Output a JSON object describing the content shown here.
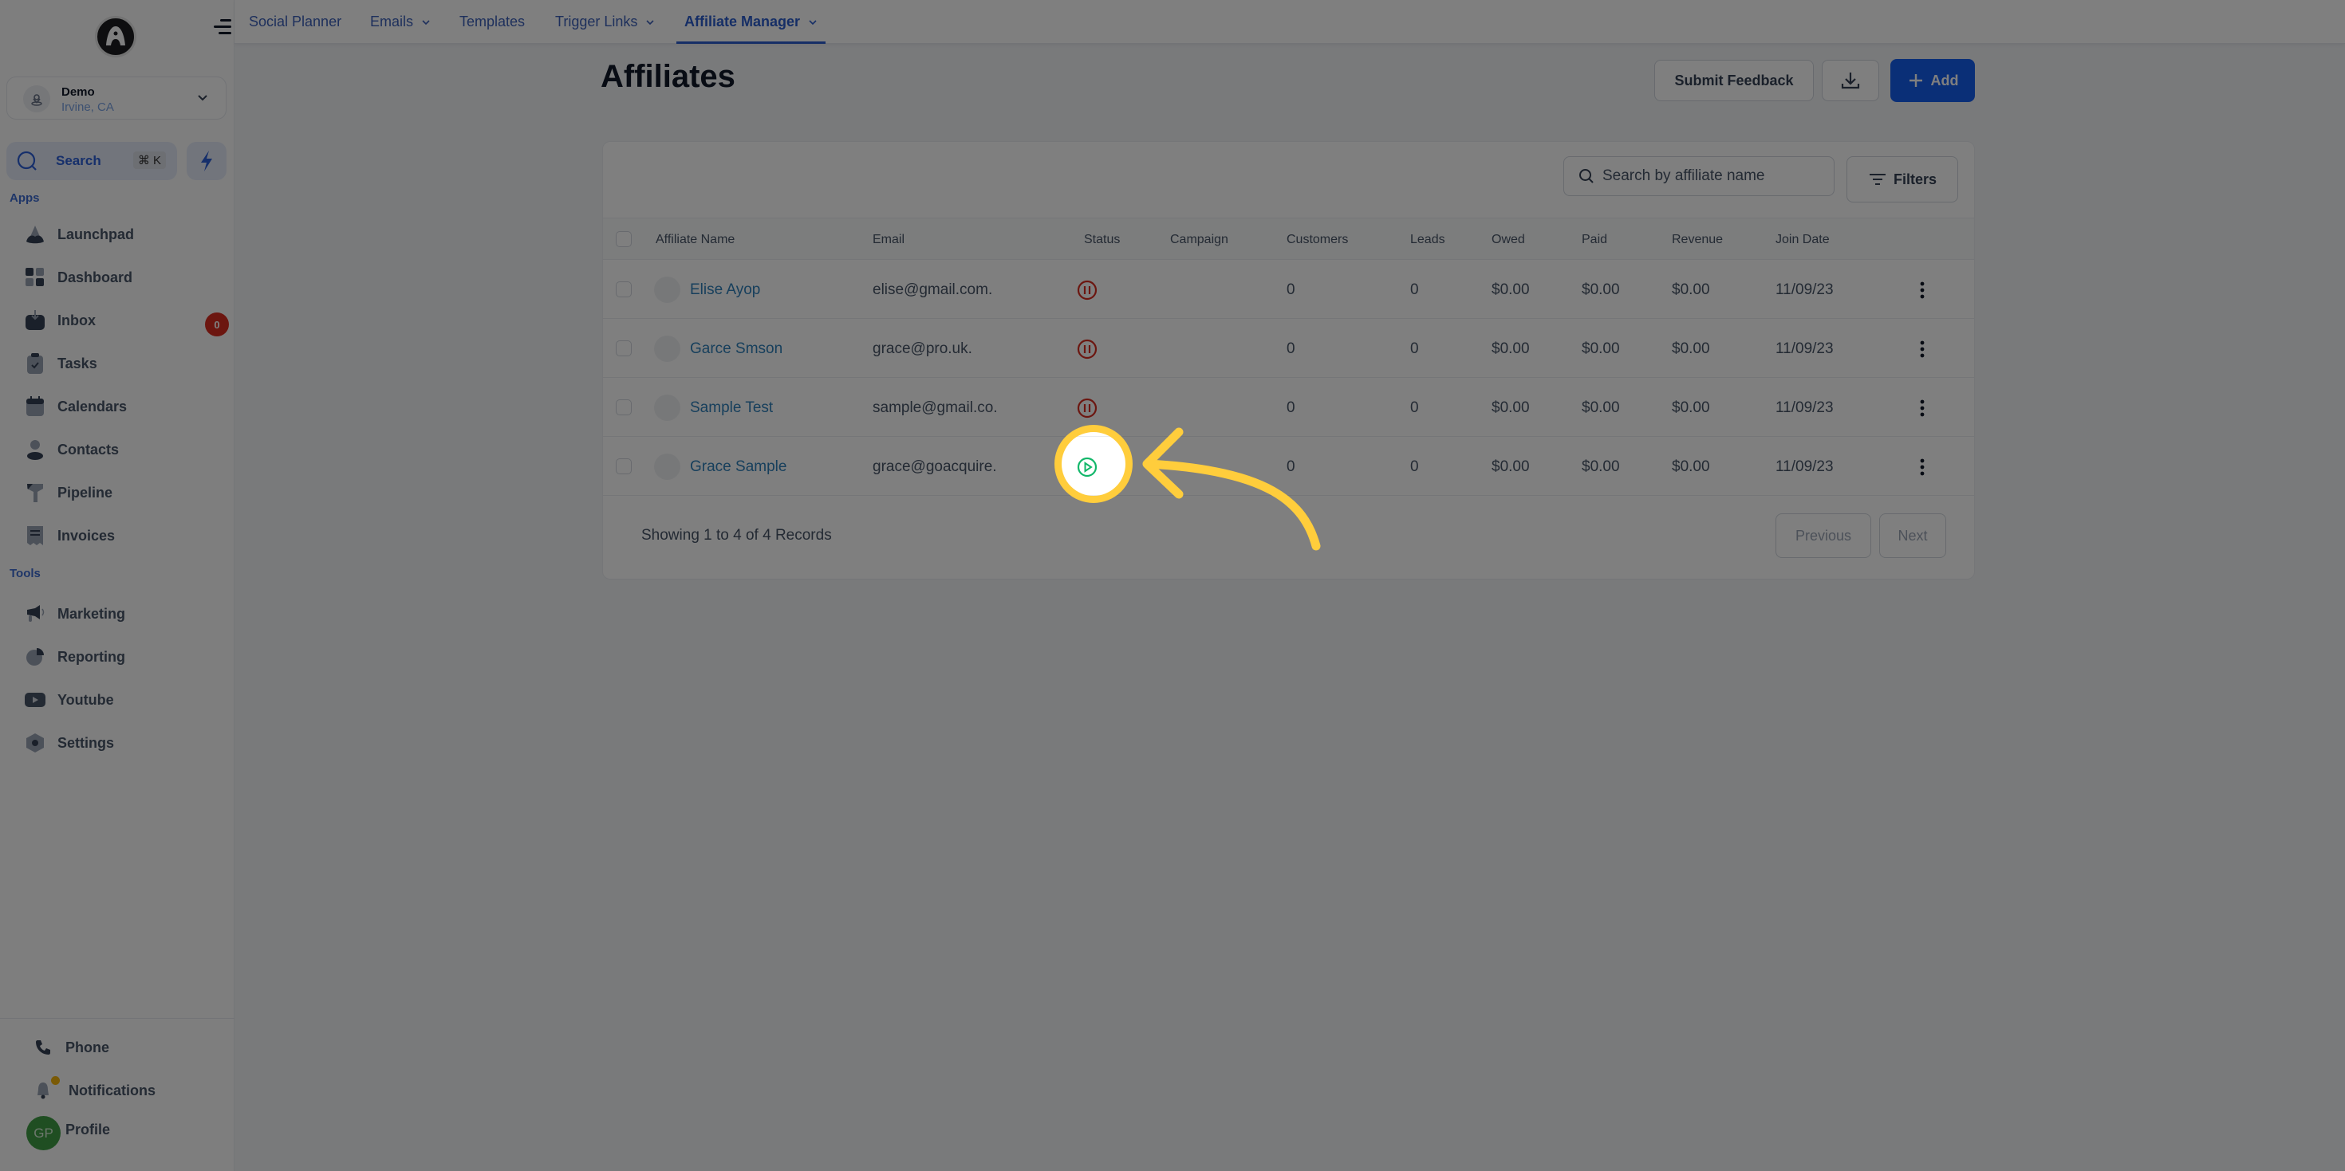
{
  "sidebar": {
    "location": {
      "name": "Demo",
      "city": "Irvine, CA"
    },
    "search": {
      "label": "Search",
      "shortcut": "⌘ K"
    },
    "sections": {
      "apps": "Apps",
      "tools": "Tools"
    },
    "apps": [
      {
        "label": "Launchpad",
        "icon": "rocket-icon"
      },
      {
        "label": "Dashboard",
        "icon": "dashboard-icon"
      },
      {
        "label": "Inbox",
        "icon": "inbox-icon",
        "badge": "0"
      },
      {
        "label": "Tasks",
        "icon": "clipboard-check-icon"
      },
      {
        "label": "Calendars",
        "icon": "calendar-icon"
      },
      {
        "label": "Contacts",
        "icon": "user-icon"
      },
      {
        "label": "Pipeline",
        "icon": "funnel-icon"
      },
      {
        "label": "Invoices",
        "icon": "receipt-icon"
      }
    ],
    "tools": [
      {
        "label": "Marketing",
        "icon": "megaphone-icon"
      },
      {
        "label": "Reporting",
        "icon": "pie-chart-icon"
      },
      {
        "label": "Youtube",
        "icon": "youtube-icon"
      },
      {
        "label": "Settings",
        "icon": "settings-hex-icon"
      }
    ],
    "bottom": {
      "phone": "Phone",
      "notifications": "Notifications",
      "profile": "Profile",
      "profile_initials": "GP"
    }
  },
  "topnav": {
    "tabs": [
      {
        "label": "Social Planner",
        "dropdown": false
      },
      {
        "label": "Emails",
        "dropdown": true
      },
      {
        "label": "Templates",
        "dropdown": false
      },
      {
        "label": "Trigger Links",
        "dropdown": true
      },
      {
        "label": "Affiliate Manager",
        "dropdown": true,
        "active": true
      }
    ]
  },
  "page": {
    "title": "Affiliates",
    "actions": {
      "feedback": "Submit Feedback",
      "download": "download-icon",
      "add": "Add"
    }
  },
  "table": {
    "search_placeholder": "Search by affiliate name",
    "filters_label": "Filters",
    "columns": [
      "Affiliate Name",
      "Email",
      "Status",
      "Campaign",
      "Customers",
      "Leads",
      "Owed",
      "Paid",
      "Revenue",
      "Join Date"
    ],
    "rows": [
      {
        "name": "Elise Ayop",
        "email": "elise@gmail.com.",
        "status": "paused",
        "campaign": "",
        "customers": "0",
        "leads": "0",
        "owed": "$0.00",
        "paid": "$0.00",
        "revenue": "$0.00",
        "join_date": "11/09/23"
      },
      {
        "name": "Garce Smson",
        "email": "grace@pro.uk.",
        "status": "paused",
        "campaign": "",
        "customers": "0",
        "leads": "0",
        "owed": "$0.00",
        "paid": "$0.00",
        "revenue": "$0.00",
        "join_date": "11/09/23"
      },
      {
        "name": "Sample Test",
        "email": "sample@gmail.co.",
        "status": "paused",
        "campaign": "",
        "customers": "0",
        "leads": "0",
        "owed": "$0.00",
        "paid": "$0.00",
        "revenue": "$0.00",
        "join_date": "11/09/23"
      },
      {
        "name": "Grace Sample",
        "email": "grace@goacquire.",
        "status": "active",
        "campaign": "",
        "customers": "0",
        "leads": "0",
        "owed": "$0.00",
        "paid": "$0.00",
        "revenue": "$0.00",
        "join_date": "11/09/23"
      }
    ],
    "footer": "Showing 1 to 4 of 4 Records",
    "pagination": {
      "previous": "Previous",
      "next": "Next"
    }
  },
  "colors": {
    "primary": "#155eef",
    "paused": "#d92d20",
    "active": "#12b76a",
    "highlight": "#ffcd3c"
  }
}
